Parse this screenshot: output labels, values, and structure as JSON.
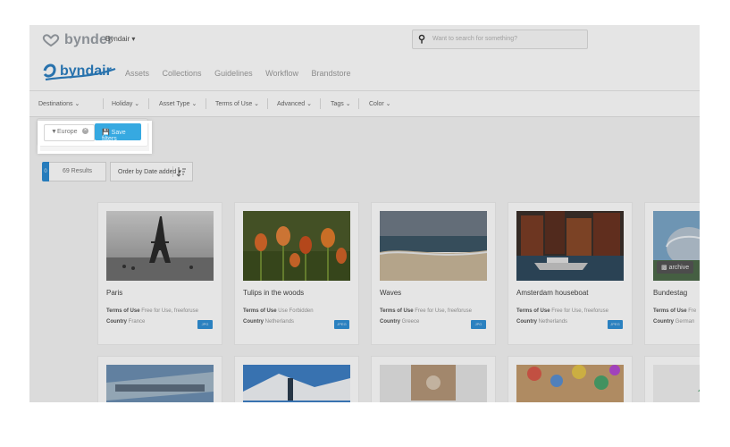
{
  "topbar": {
    "logo_text": "bynder",
    "portal_selector": "Byndair ▾",
    "search_placeholder": "Want to search for something?"
  },
  "navbar": {
    "brand": "byndair",
    "links": [
      "Assets",
      "Collections",
      "Guidelines",
      "Workflow",
      "Brandstore"
    ]
  },
  "filters": {
    "items": [
      "Destinations ⌄",
      "Holiday ⌄",
      "Asset Type ⌄",
      "Terms of Use ⌄",
      "Advanced ⌄",
      "Tags ⌄",
      "Color ⌄"
    ]
  },
  "active_filters": {
    "chip_label": "Europe",
    "save_label": "Save filters"
  },
  "results": {
    "selected_count": "0",
    "results_label": "69 Results",
    "order_label": "Order by Date added ▾"
  },
  "assets": [
    {
      "title": "Paris",
      "tou_label": "Terms of Use",
      "tou_value": "Free for Use, freeforuse",
      "country_label": "Country",
      "country_value": "France",
      "badge": "JPG",
      "image": "eiffel-tower-bw"
    },
    {
      "title": "Tulips in the woods",
      "tou_label": "Terms of Use",
      "tou_value": "Use Forbidden",
      "country_label": "Country",
      "country_value": "Netherlands",
      "badge": "JPEG",
      "image": "tulips"
    },
    {
      "title": "Waves",
      "tou_label": "Terms of Use",
      "tou_value": "Free for Use, freeforuse",
      "country_label": "Country",
      "country_value": "Greece",
      "badge": "JPG",
      "image": "beach-waves"
    },
    {
      "title": "Amsterdam houseboat",
      "tou_label": "Terms of Use",
      "tou_value": "Free for Use, freeforuse",
      "country_label": "Country",
      "country_value": "Netherlands",
      "badge": "JPEG",
      "image": "canal-houseboat"
    },
    {
      "title": "Bundestag",
      "tou_label": "Terms of Use",
      "tou_value": "Fre",
      "country_label": "Country",
      "country_value": "German",
      "archive_label": "archive",
      "image": "bundestag-dome"
    }
  ]
}
